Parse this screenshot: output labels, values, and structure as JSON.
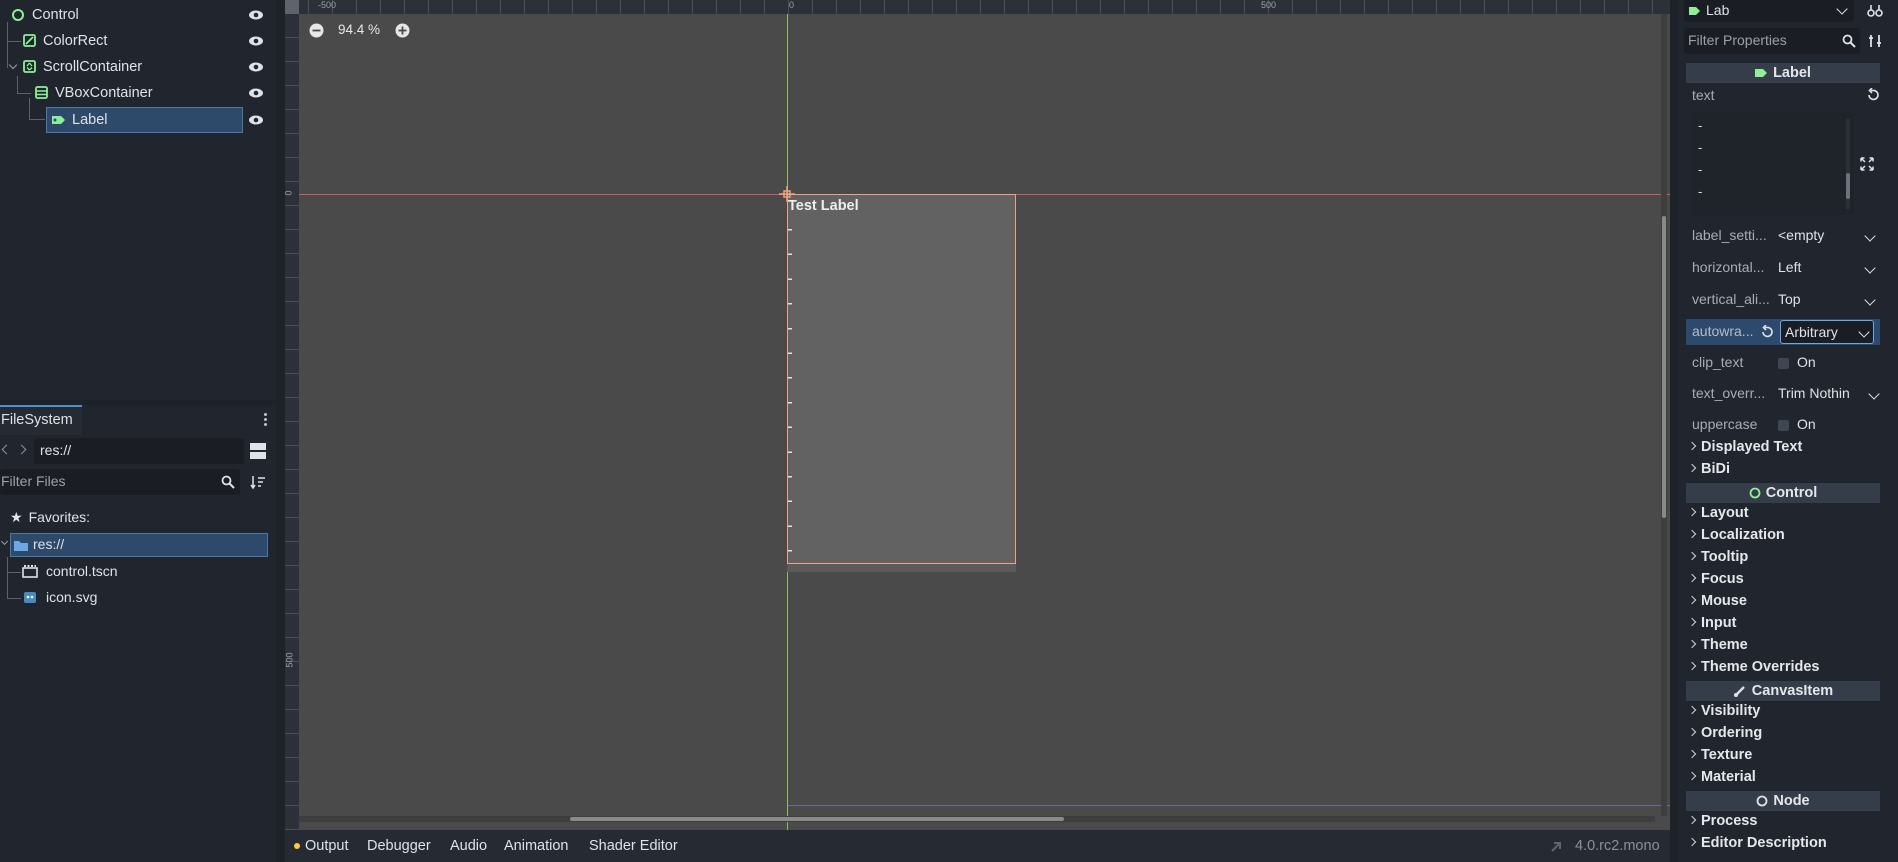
{
  "scene_tree": {
    "nodes": [
      {
        "label": "Control"
      },
      {
        "label": "ColorRect"
      },
      {
        "label": "ScrollContainer"
      },
      {
        "label": "VBoxContainer"
      },
      {
        "label": "Label"
      }
    ]
  },
  "filesystem": {
    "tab_label": "FileSystem",
    "path": "res://",
    "filter_placeholder": "Filter Files",
    "favorites_label": "Favorites:",
    "root": "res://",
    "files": [
      "control.tscn",
      "icon.svg"
    ]
  },
  "viewport": {
    "zoom": "94.4 %",
    "ruler_top": [
      "-500",
      "0",
      "500"
    ],
    "ruler_left": [
      "0",
      "500"
    ],
    "label_text": "Test Label",
    "colors": {
      "selection": "#f0a27c",
      "x_axis": "#d25a5a",
      "y_axis": "#8fbf5a"
    }
  },
  "bottom_bar": {
    "tabs": [
      "Output",
      "Debugger",
      "Audio",
      "Animation",
      "Shader Editor"
    ],
    "version": "4.0.rc2.mono"
  },
  "inspector": {
    "node_select": "Lab",
    "filter_placeholder": "Filter Properties",
    "class_label": "Label",
    "text_prop": "text",
    "text_lines": [
      "-",
      "-",
      "-",
      "-"
    ],
    "props": [
      {
        "name": "label_setti...",
        "value": "<empty"
      },
      {
        "name": "horizontal...",
        "value": "Left"
      },
      {
        "name": "vertical_ali...",
        "value": "Top"
      },
      {
        "name": "autowra...",
        "value": "Arbitrary"
      },
      {
        "name": "clip_text",
        "value": "On"
      },
      {
        "name": "text_overr...",
        "value": "Trim Nothin"
      },
      {
        "name": "uppercase",
        "value": "On"
      }
    ],
    "label_sections": [
      "Displayed Text",
      "BiDi"
    ],
    "control_label": "Control",
    "control_sections": [
      "Layout",
      "Localization",
      "Tooltip",
      "Focus",
      "Mouse",
      "Input",
      "Theme",
      "Theme Overrides"
    ],
    "canvas_label": "CanvasItem",
    "canvas_sections": [
      "Visibility",
      "Ordering",
      "Texture",
      "Material"
    ],
    "node_label": "Node",
    "node_sections": [
      "Process",
      "Editor Description"
    ]
  }
}
